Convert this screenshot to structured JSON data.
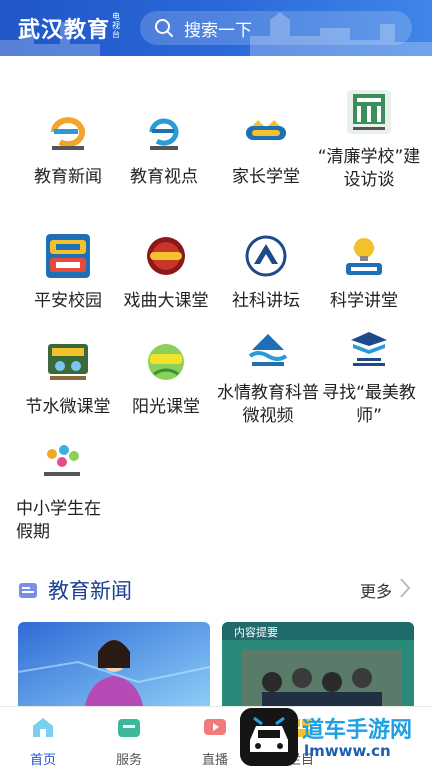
{
  "header": {
    "title": "武汉教育",
    "subtitle": "电视台",
    "search_placeholder": "搜索一下"
  },
  "grid": [
    {
      "label": "教育新闻",
      "icon": "education-news-logo"
    },
    {
      "label": "教育视点",
      "icon": "education-viewpoint-logo"
    },
    {
      "label": "家长学堂",
      "icon": "parent-school-logo"
    },
    {
      "label": "“清廉学校”建设访谈",
      "icon": "clean-school-logo"
    },
    {
      "label": "平安校园",
      "icon": "safe-campus-logo"
    },
    {
      "label": "戏曲大课堂",
      "icon": "opera-class-logo"
    },
    {
      "label": "社科讲坛",
      "icon": "social-science-forum-logo"
    },
    {
      "label": "科学讲堂",
      "icon": "science-lecture-logo"
    },
    {
      "label": "节水微课堂",
      "icon": "water-saving-class-logo"
    },
    {
      "label": "阳光课堂",
      "icon": "sunshine-class-logo"
    },
    {
      "label": "水情教育科普微视频",
      "icon": "water-education-logo"
    },
    {
      "label": "寻找“最美教师”",
      "icon": "best-teacher-logo"
    },
    {
      "label": "中小学生在假期",
      "icon": "students-holiday-logo"
    }
  ],
  "section": {
    "title": "教育新闻",
    "more": "更多"
  },
  "cards": [
    {
      "caption": ""
    },
    {
      "caption": "内容提要"
    }
  ],
  "tabbar": [
    {
      "label": "首页",
      "icon": "home-icon"
    },
    {
      "label": "服务",
      "icon": "service-icon"
    },
    {
      "label": "直播",
      "icon": "live-icon"
    },
    {
      "label": "栏目",
      "icon": "column-icon"
    }
  ],
  "watermark": {
    "title": "道车手游网",
    "url": "lmwww.cn"
  },
  "colors": {
    "brand": "#1f56c8",
    "section_title": "#1c3f8f"
  }
}
